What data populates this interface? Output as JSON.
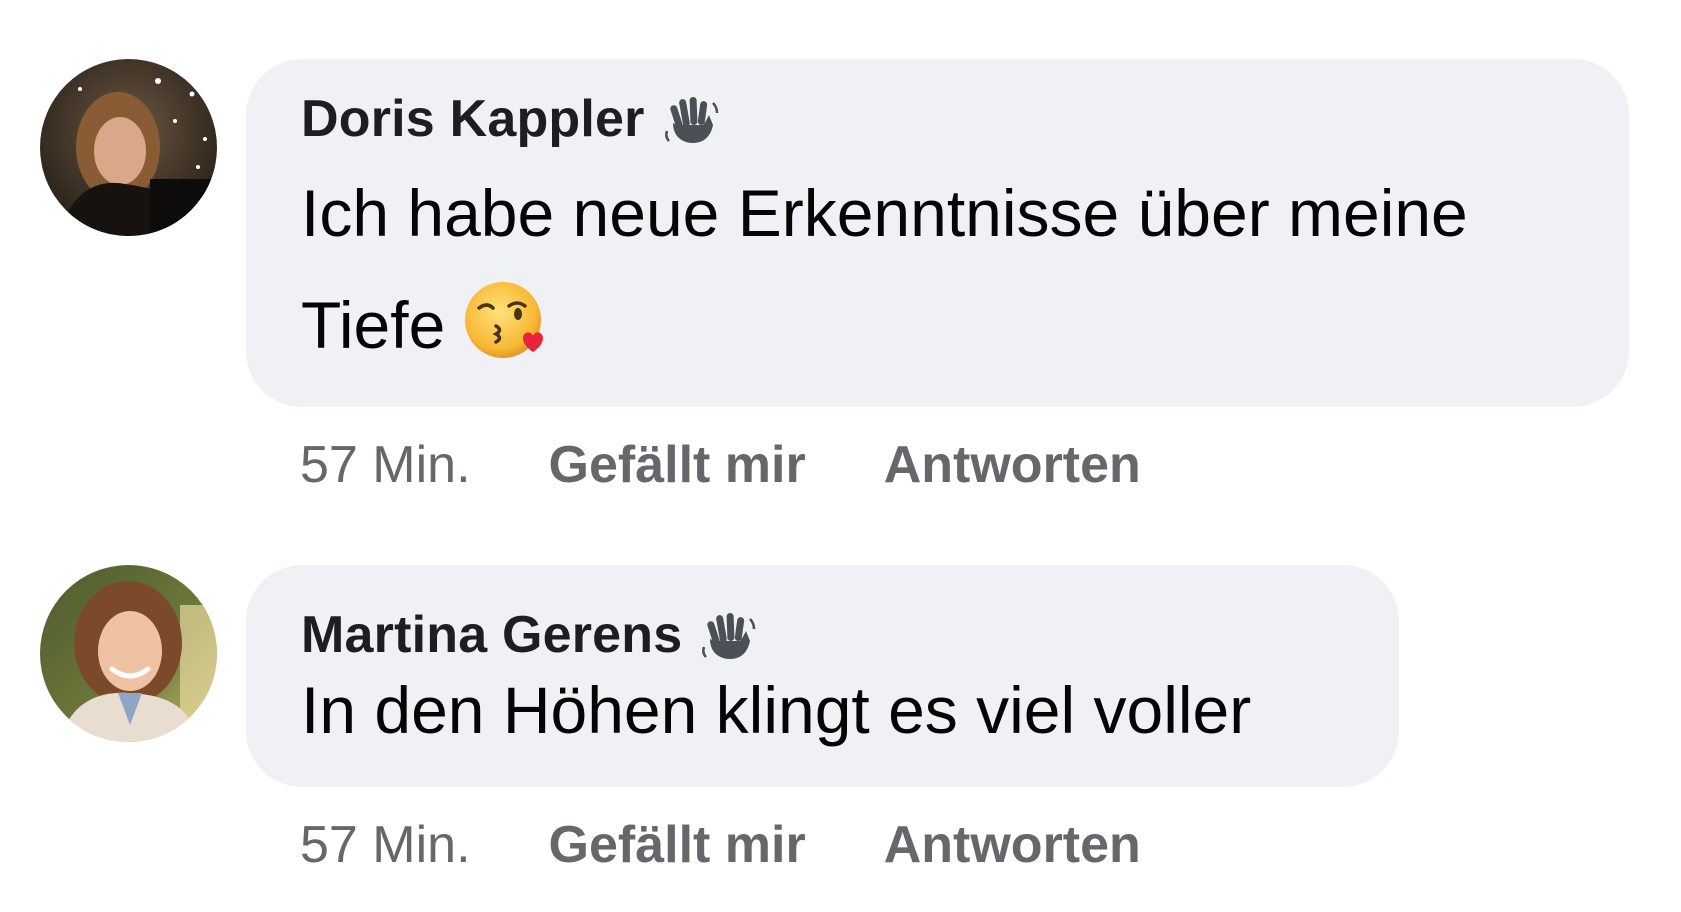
{
  "comments": [
    {
      "author": "Doris Kappler",
      "author_badge_icon": "waving-hand-icon",
      "text_line1": "Ich habe neue Erkenntnisse über meine",
      "text_line2": "Tiefe",
      "emoji": "face-blowing-kiss-icon",
      "time": "57 Min.",
      "like_label": "Gefällt mir",
      "reply_label": "Antworten"
    },
    {
      "author": "Martina Gerens",
      "author_badge_icon": "waving-hand-icon",
      "text_line1": "In den Höhen klingt es viel voller",
      "time": "57 Min.",
      "like_label": "Gefällt mir",
      "reply_label": "Antworten"
    }
  ],
  "colors": {
    "bubble_background": "#f0f1f5",
    "author_text": "#1c1e21",
    "body_text": "#050505",
    "meta_text": "#65676b"
  }
}
